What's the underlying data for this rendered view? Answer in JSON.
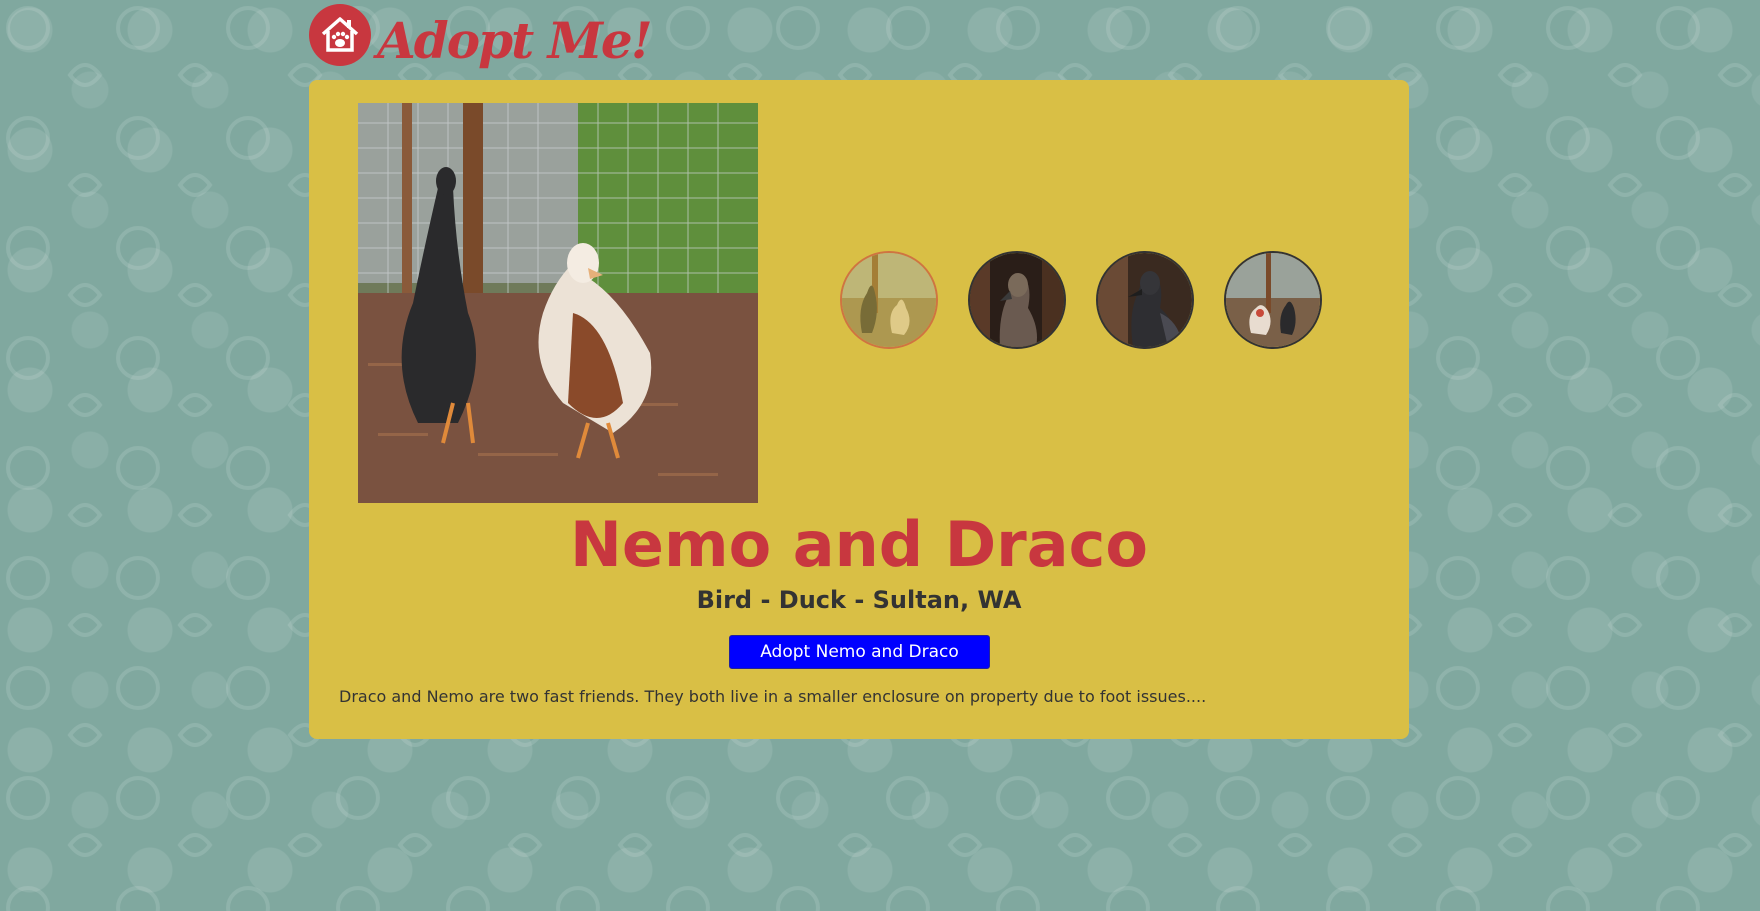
{
  "header": {
    "logo_text": "Adopt Me!",
    "logo_icon": "house-paw-icon"
  },
  "pet": {
    "name": "Nemo and Draco",
    "meta": "Bird - Duck - Sultan, WA",
    "adopt_label": "Adopt Nemo and Draco",
    "description": "Draco and Nemo are two fast friends. They both live in a smaller enclosure on property due to foot issues...."
  },
  "gallery": {
    "active_index": 0,
    "thumbnail_count": 4
  },
  "colors": {
    "background": "#80a89f",
    "card": "#d9bf45",
    "brand_red": "#c8373f",
    "button_blue": "#0000ff",
    "text_dark": "#333333"
  }
}
